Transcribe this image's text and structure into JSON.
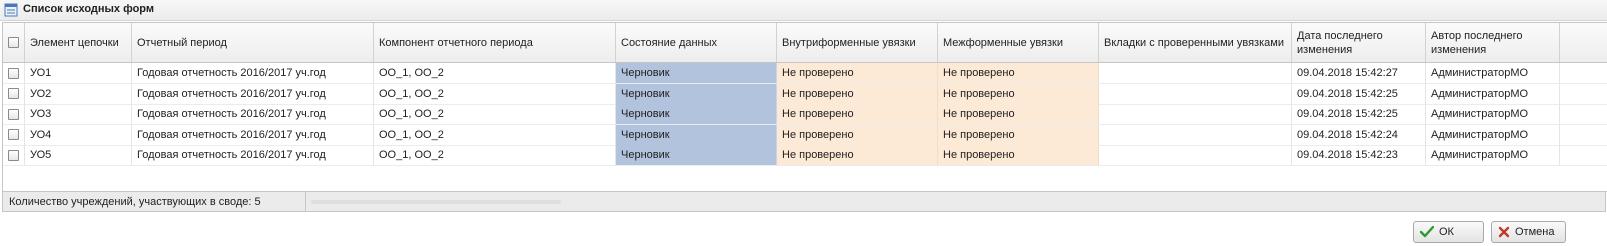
{
  "window": {
    "title": "Список исходных форм"
  },
  "columns": [
    "",
    "Элемент цепочки",
    "Отчетный период",
    "Компонент отчетного периода",
    "Состояние данных",
    "Внутриформенные увязки",
    "Межформенные увязки",
    "Вкладки с проверенными увязками",
    "Дата последнего изменения",
    "Автор последнего изменения"
  ],
  "rows": [
    [
      "",
      "УО1",
      "Годовая отчетность 2016/2017 уч.год",
      "ОО_1, ОО_2",
      "Черновик",
      "Не проверено",
      "Не проверено",
      "",
      "09.04.2018 15:42:27",
      "АдминистраторМО"
    ],
    [
      "",
      "УО2",
      "Годовая отчетность 2016/2017 уч.год",
      "ОО_1, ОО_2",
      "Черновик",
      "Не проверено",
      "Не проверено",
      "",
      "09.04.2018 15:42:25",
      "АдминистраторМО"
    ],
    [
      "",
      "УО3",
      "Годовая отчетность 2016/2017 уч.год",
      "ОО_1, ОО_2",
      "Черновик",
      "Не проверено",
      "Не проверено",
      "",
      "09.04.2018 15:42:25",
      "АдминистраторМО"
    ],
    [
      "",
      "УО4",
      "Годовая отчетность 2016/2017 уч.год",
      "ОО_1, ОО_2",
      "Черновик",
      "Не проверено",
      "Не проверено",
      "",
      "09.04.2018 15:42:24",
      "АдминистраторМО"
    ],
    [
      "",
      "УО5",
      "Годовая отчетность 2016/2017 уч.год",
      "ОО_1, ОО_2",
      "Черновик",
      "Не проверено",
      "Не проверено",
      "",
      "09.04.2018 15:42:23",
      "АдминистраторМО"
    ]
  ],
  "status": {
    "text": "Количество учреждений, участвующих в своде: 5"
  },
  "buttons": {
    "ok": "ОК",
    "cancel": "Отмена"
  },
  "colors": {
    "state_bg": "#b2c3dd",
    "check_bg": "#fce9d6",
    "ok_icon": "#2e9a2e",
    "cancel_icon": "#c0392b"
  },
  "icons": {
    "title": "form-list-icon",
    "ok": "checkmark-icon",
    "cancel": "close-icon"
  }
}
